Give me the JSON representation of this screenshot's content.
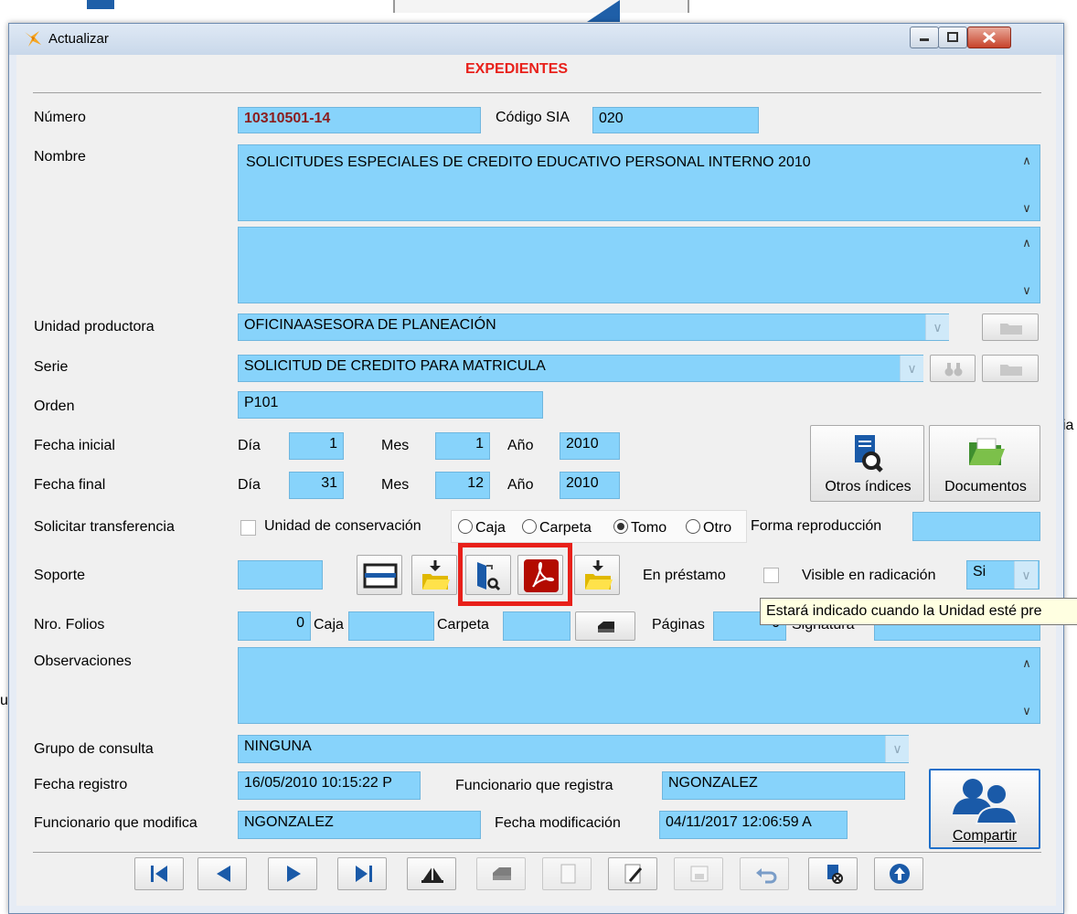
{
  "background": {
    "frag_right": "ia",
    "frag_left": "u"
  },
  "window": {
    "title": "Actualizar",
    "form_title": "EXPEDIENTES"
  },
  "fields": {
    "numero": {
      "label": "Número",
      "value": "10310501-14"
    },
    "codigo_sia": {
      "label": "Código SIA",
      "value": "020"
    },
    "nombre": {
      "label": "Nombre",
      "value": "SOLICITUDES ESPECIALES DE CREDITO EDUCATIVO PERSONAL INTERNO 2010"
    },
    "unidad_productora": {
      "label": "Unidad productora",
      "value": "OFICINAASESORA DE PLANEACIÓN"
    },
    "serie": {
      "label": "Serie",
      "value": "SOLICITUD DE CREDITO PARA MATRICULA"
    },
    "orden": {
      "label": "Orden",
      "value": "P101"
    },
    "fecha_inicial": {
      "label": "Fecha inicial",
      "dia_label": "Día",
      "dia": "1",
      "mes_label": "Mes",
      "mes": "1",
      "anio_label": "Año",
      "anio": "2010"
    },
    "fecha_final": {
      "label": "Fecha final",
      "dia_label": "Día",
      "dia": "31",
      "mes_label": "Mes",
      "mes": "12",
      "anio_label": "Año",
      "anio": "2010"
    },
    "solicitar_transferencia": {
      "label": "Solicitar transferencia"
    },
    "unidad_conservacion": {
      "label": "Unidad de conservación",
      "options": [
        "Caja",
        "Carpeta",
        "Tomo",
        "Otro"
      ],
      "selected": "Tomo"
    },
    "forma_reproduccion": {
      "label": "Forma reproducción",
      "value": ""
    },
    "soporte": {
      "label": "Soporte",
      "value": ""
    },
    "en_prestamo": {
      "label": "En préstamo"
    },
    "visible_radicacion": {
      "label": "Visible en radicación",
      "value": "Si"
    },
    "nro_folios": {
      "label": "Nro. Folios",
      "value": "0"
    },
    "caja": {
      "label": "Caja",
      "value": ""
    },
    "carpeta": {
      "label": "Carpeta",
      "value": ""
    },
    "paginas": {
      "label": "Páginas",
      "value": "0"
    },
    "signatura": {
      "label": "Signatura",
      "value": ""
    },
    "observaciones": {
      "label": "Observaciones",
      "value": ""
    },
    "grupo_consulta": {
      "label": "Grupo de consulta",
      "value": "NINGUNA"
    },
    "fecha_registro": {
      "label": "Fecha registro",
      "value": "16/05/2010 10:15:22 P"
    },
    "funcionario_registra": {
      "label": "Funcionario que registra",
      "value": "NGONZALEZ"
    },
    "funcionario_modifica": {
      "label": "Funcionario que modifica",
      "value": "NGONZALEZ"
    },
    "fecha_modificacion": {
      "label": "Fecha modificación",
      "value": "04/11/2017 12:06:59 A"
    }
  },
  "buttons": {
    "otros_indices": "Otros índices",
    "documentos": "Documentos",
    "compartir": "Compartir"
  },
  "tooltip": "Estará indicado cuando la Unidad esté pre",
  "colors": {
    "field_bg": "#87d3fb",
    "title_red": "#e8201a",
    "highlight_red": "#e8201a",
    "numero_text": "#8b1d1d"
  }
}
